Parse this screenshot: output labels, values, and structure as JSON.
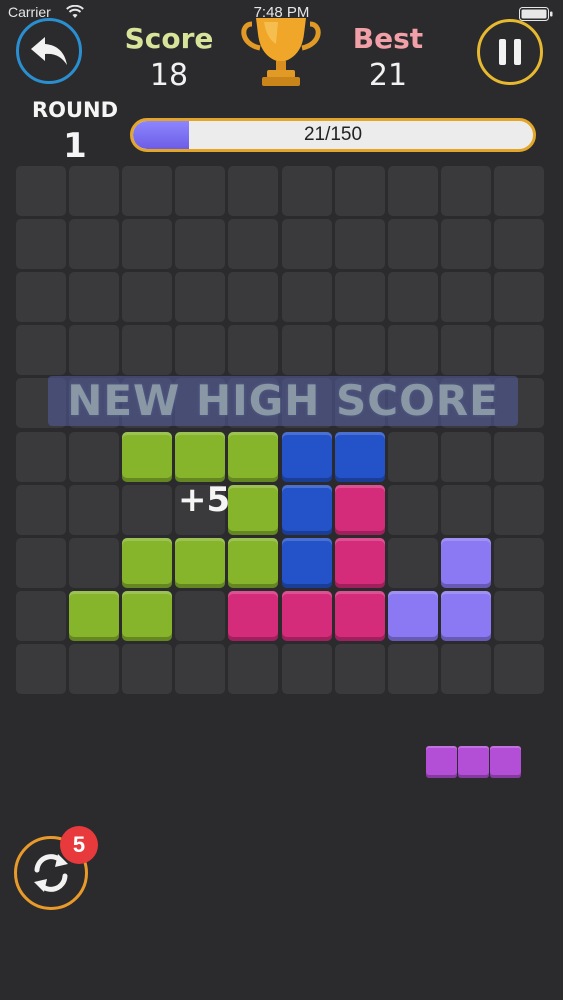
{
  "status_bar": {
    "carrier": "Carrier",
    "time": "7:48 PM"
  },
  "header": {
    "score_label": "Score",
    "score_value": "18",
    "best_label": "Best",
    "best_value": "21",
    "round_label": "ROUND",
    "round_value": "1",
    "progress_text": "21/150",
    "progress_fraction": 0.14
  },
  "colors": {
    "green": "#86b52c",
    "blue": "#2352c9",
    "pink": "#d42b7b",
    "lavender": "#8a79f2",
    "next_piece": "#b34ed6",
    "empty_cell": "#3a3a3c"
  },
  "board": {
    "rows": 10,
    "cols": 10,
    "blocks": [
      {
        "row": 5,
        "col": 2,
        "color": "green"
      },
      {
        "row": 5,
        "col": 3,
        "color": "green"
      },
      {
        "row": 5,
        "col": 4,
        "color": "green"
      },
      {
        "row": 5,
        "col": 5,
        "color": "blue"
      },
      {
        "row": 5,
        "col": 6,
        "color": "blue"
      },
      {
        "row": 6,
        "col": 4,
        "color": "green"
      },
      {
        "row": 6,
        "col": 5,
        "color": "blue"
      },
      {
        "row": 6,
        "col": 6,
        "color": "pink"
      },
      {
        "row": 7,
        "col": 2,
        "color": "green"
      },
      {
        "row": 7,
        "col": 3,
        "color": "green"
      },
      {
        "row": 7,
        "col": 4,
        "color": "green"
      },
      {
        "row": 7,
        "col": 5,
        "color": "blue"
      },
      {
        "row": 7,
        "col": 6,
        "color": "pink"
      },
      {
        "row": 7,
        "col": 8,
        "color": "lavender"
      },
      {
        "row": 8,
        "col": 1,
        "color": "green"
      },
      {
        "row": 8,
        "col": 2,
        "color": "green"
      },
      {
        "row": 8,
        "col": 4,
        "color": "pink"
      },
      {
        "row": 8,
        "col": 5,
        "color": "pink"
      },
      {
        "row": 8,
        "col": 6,
        "color": "pink"
      },
      {
        "row": 8,
        "col": 7,
        "color": "lavender"
      },
      {
        "row": 8,
        "col": 8,
        "color": "lavender"
      }
    ]
  },
  "banner_text": "NEW HIGH SCORE",
  "bonus_text": "+5",
  "next_piece": {
    "blocks": 3,
    "color": "next_piece"
  },
  "refresh": {
    "badge_count": "5"
  },
  "icons": {
    "back": "back-arrow-icon",
    "pause": "pause-icon",
    "trophy": "trophy-icon",
    "refresh": "refresh-icon",
    "wifi": "wifi-icon",
    "battery": "battery-icon"
  }
}
